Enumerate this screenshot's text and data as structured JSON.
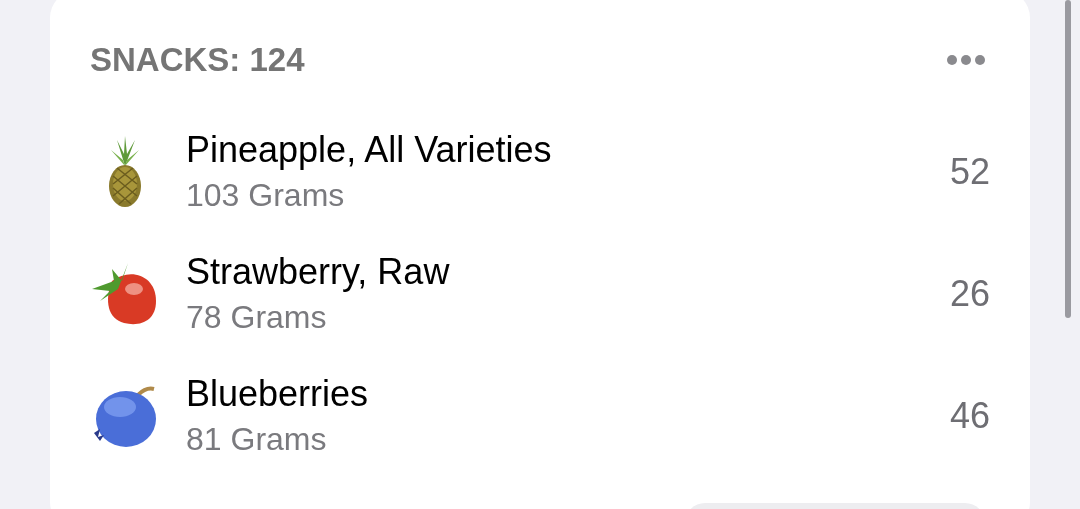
{
  "card": {
    "title": "SNACKS: 124",
    "items": [
      {
        "kind": "pineapple",
        "name": "Pineapple, All Varieties",
        "amount": "103 Grams",
        "value": "52"
      },
      {
        "kind": "strawberry",
        "name": "Strawberry, Raw",
        "amount": "78 Grams",
        "value": "26"
      },
      {
        "kind": "blueberry",
        "name": "Blueberries",
        "amount": "81 Grams",
        "value": "46"
      }
    ]
  }
}
